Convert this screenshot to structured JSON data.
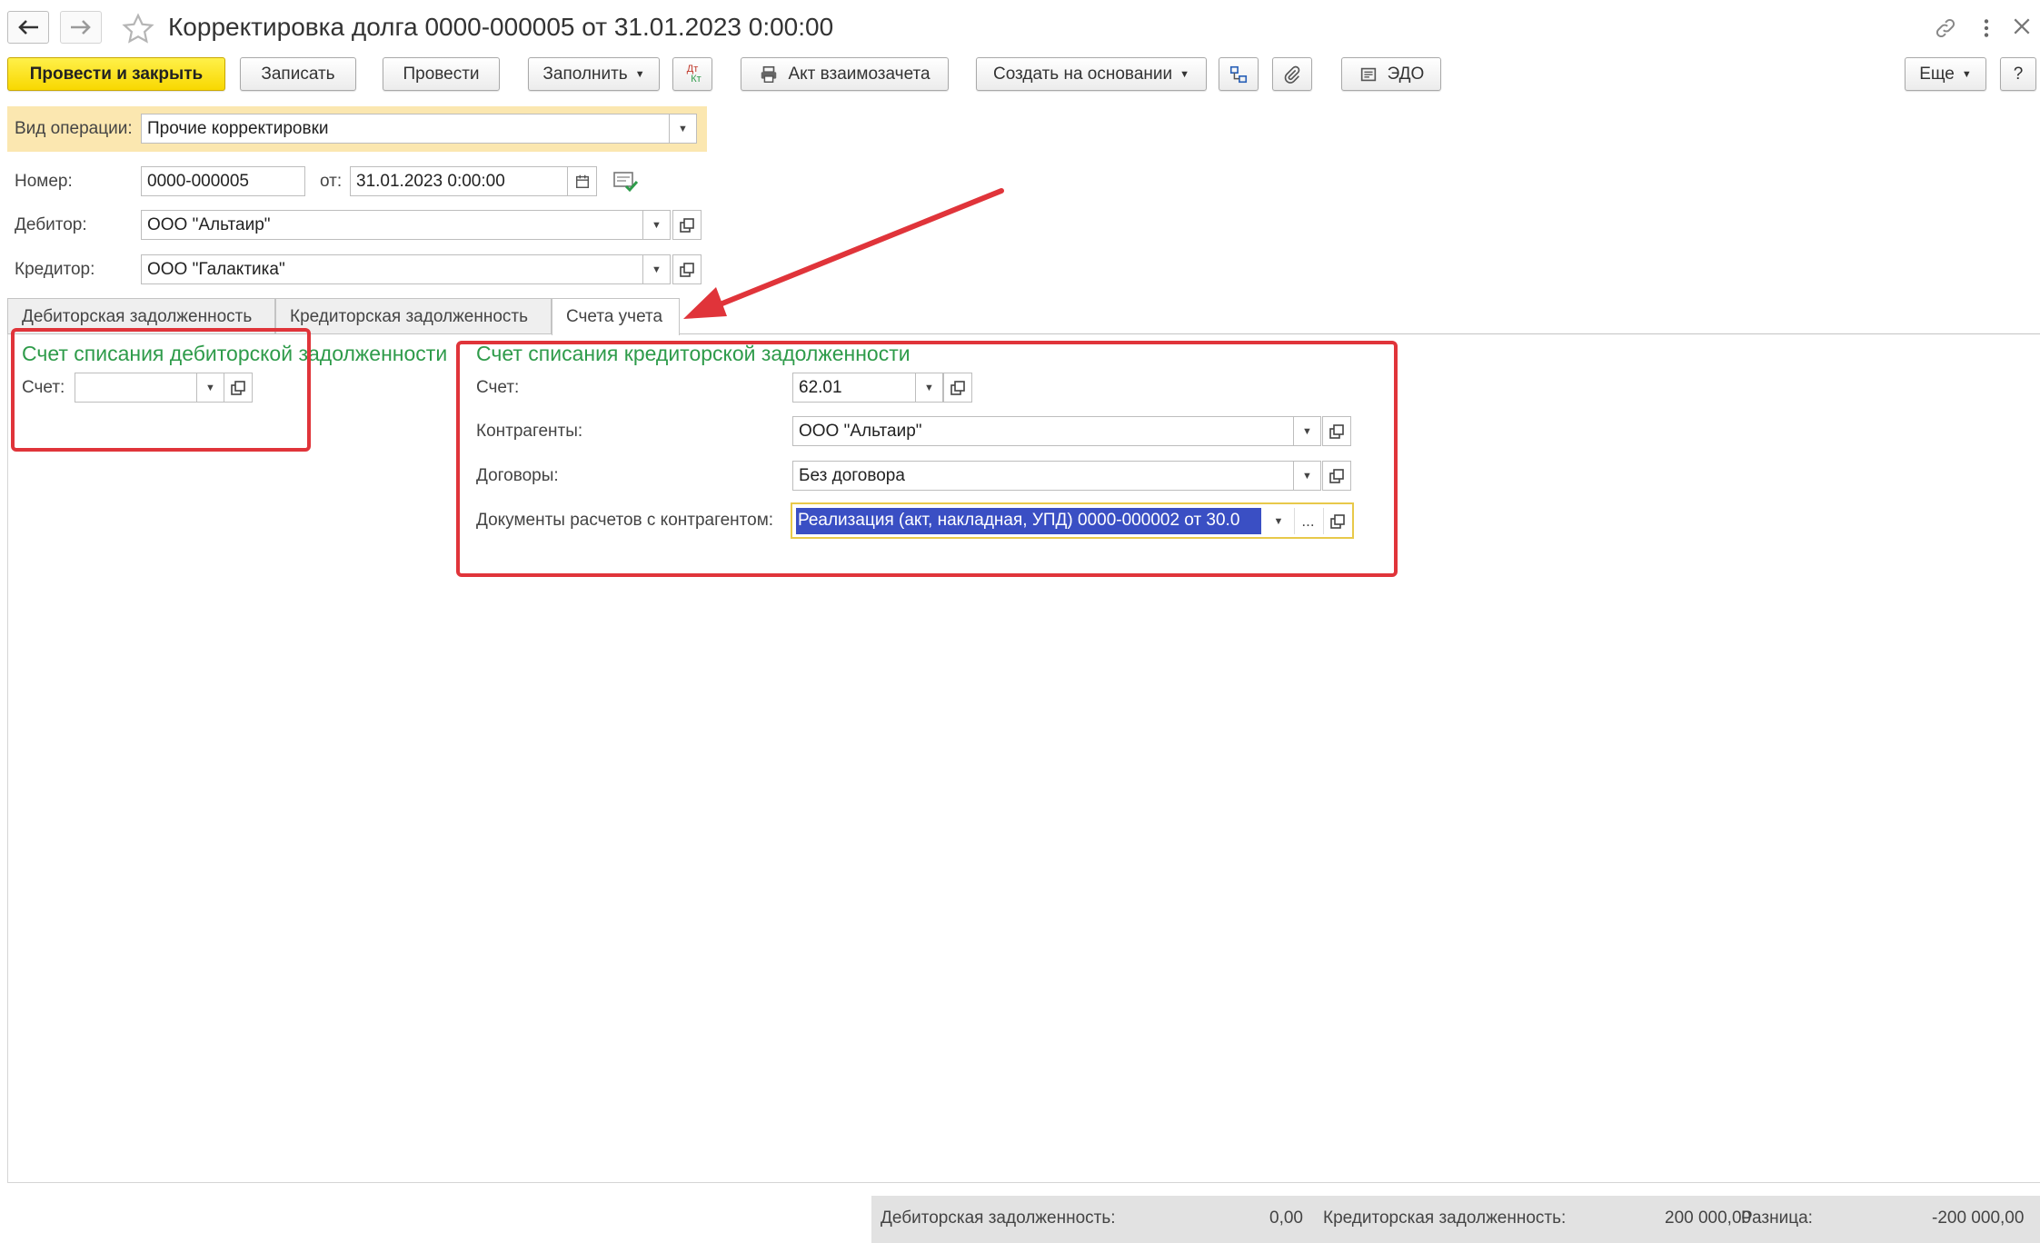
{
  "window": {
    "title": "Корректировка долга 0000-000005 от 31.01.2023 0:00:00"
  },
  "toolbar": {
    "post_and_close": "Провести и закрыть",
    "save": "Записать",
    "post": "Провести",
    "fill": "Заполнить",
    "dt_kt_top": "Дт",
    "dt_kt_bottom": "Кт",
    "offset_act": "Акт взаимозачета",
    "create_based_on": "Создать на основании",
    "edo": "ЭДО",
    "more": "Еще",
    "help": "?"
  },
  "operation": {
    "label": "Вид операции:",
    "value": "Прочие корректировки"
  },
  "header": {
    "number_label": "Номер:",
    "number_value": "0000-000005",
    "date_label": "от:",
    "date_value": "31.01.2023  0:00:00",
    "debtor_label": "Дебитор:",
    "debtor_value": "ООО \"Альтаир\"",
    "creditor_label": "Кредитор:",
    "creditor_value": "ООО \"Галактика\""
  },
  "tabs": [
    {
      "label": "Дебиторская задолженность"
    },
    {
      "label": "Кредиторская задолженность"
    },
    {
      "label": "Счета учета"
    }
  ],
  "debit_group": {
    "title": "Счет списания дебиторской задолженности",
    "account_label": "Счет:",
    "account_value": ""
  },
  "credit_group": {
    "title": "Счет списания кредиторской задолженности",
    "account_label": "Счет:",
    "account_value": "62.01",
    "counterparty_label": "Контрагенты:",
    "counterparty_value": "ООО \"Альтаир\"",
    "contract_label": "Договоры:",
    "contract_value": "Без договора",
    "docs_label": "Документы расчетов с контрагентом:",
    "docs_value": "Реализация (акт, накладная, УПД) 0000-000002 от 30.0",
    "ellipsis": "..."
  },
  "footer": {
    "debit_label": "Дебиторская задолженность:",
    "debit_value": "0,00",
    "credit_label": "Кредиторская задолженность:",
    "credit_value": "200 000,00",
    "diff_label": "Разница:",
    "diff_value": "-200 000,00"
  },
  "colors": {
    "accent_yellow": "#f8d800",
    "group_green": "#2e9b4a",
    "annotation_red": "#e0343a",
    "selection_blue": "#3a4fc4"
  }
}
